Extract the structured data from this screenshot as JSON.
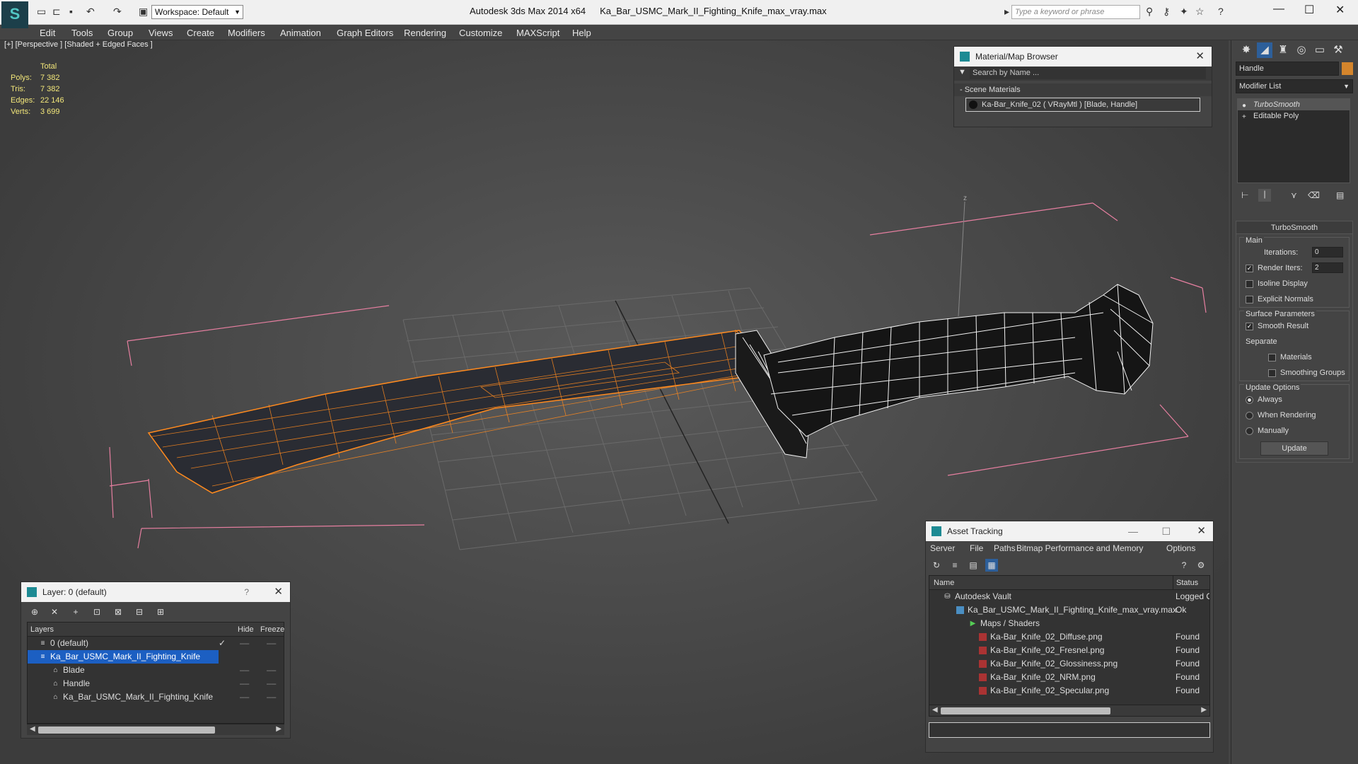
{
  "app": {
    "title": "Autodesk 3ds Max  2014 x64",
    "file": "Ka_Bar_USMC_Mark_II_Fighting_Knife_max_vray.max",
    "workspace": "Workspace: Default",
    "search_placeholder": "Type a keyword or phrase",
    "logo": "3ds-max-logo"
  },
  "menu": [
    "Edit",
    "Tools",
    "Group",
    "Views",
    "Create",
    "Modifiers",
    "Animation",
    "Graph Editors",
    "Rendering",
    "Customize",
    "MAXScript",
    "Help"
  ],
  "viewport": {
    "label": "[+] [Perspective ] [Shaded + Edged Faces ]",
    "stats": {
      "header": "Total",
      "rows": [
        {
          "label": "Polys:",
          "value": "7 382"
        },
        {
          "label": "Tris:",
          "value": "7 382"
        },
        {
          "label": "Edges:",
          "value": "22 146"
        },
        {
          "label": "Verts:",
          "value": "3 699"
        }
      ]
    },
    "axis_label": "z"
  },
  "material_browser": {
    "title": "Material/Map Browser",
    "search_placeholder": "Search by Name ...",
    "section": "- Scene Materials",
    "item": "Ka-Bar_Knife_02  ( VRayMtl )  [Blade, Handle]"
  },
  "command_panel": {
    "object_name": "Handle",
    "modifier_list": "Modifier List",
    "stack": [
      "TurboSmooth",
      "Editable Poly"
    ],
    "rollout_title": "TurboSmooth",
    "main_group": "Main",
    "iterations_label": "Iterations:",
    "iterations_value": "0",
    "render_iters_label": "Render Iters:",
    "render_iters_value": "2",
    "isoline": "Isoline Display",
    "explicit": "Explicit Normals",
    "surface_group": "Surface Parameters",
    "smooth_result": "Smooth Result",
    "separate": "Separate",
    "materials": "Materials",
    "smoothing_groups": "Smoothing Groups",
    "update_group": "Update Options",
    "always": "Always",
    "when_rendering": "When Rendering",
    "manually": "Manually",
    "update_button": "Update",
    "accent": "#d4852c"
  },
  "layer_panel": {
    "title": "Layer: 0 (default)",
    "help": "?",
    "columns": {
      "layers": "Layers",
      "hide": "Hide",
      "freeze": "Freeze"
    },
    "rows": [
      {
        "label": "0 (default)",
        "indent": 1,
        "sel": false
      },
      {
        "label": "Ka_Bar_USMC_Mark_II_Fighting_Knife",
        "indent": 1,
        "sel": true
      },
      {
        "label": "Blade",
        "indent": 2,
        "sel": false
      },
      {
        "label": "Handle",
        "indent": 2,
        "sel": false
      },
      {
        "label": "Ka_Bar_USMC_Mark_II_Fighting_Knife",
        "indent": 2,
        "sel": false
      }
    ]
  },
  "asset_tracking": {
    "title": "Asset Tracking",
    "menu": [
      "Server",
      "File",
      "Paths",
      "Bitmap Performance and Memory",
      "Options"
    ],
    "columns": {
      "name": "Name",
      "status": "Status"
    },
    "rows": [
      {
        "name": "Autodesk Vault",
        "status": "Logged O",
        "indent": 1
      },
      {
        "name": "Ka_Bar_USMC_Mark_II_Fighting_Knife_max_vray.max",
        "status": "Ok",
        "indent": 2
      },
      {
        "name": "Maps / Shaders",
        "status": "",
        "indent": 3
      },
      {
        "name": "Ka-Bar_Knife_02_Diffuse.png",
        "status": "Found",
        "indent": 4
      },
      {
        "name": "Ka-Bar_Knife_02_Fresnel.png",
        "status": "Found",
        "indent": 4
      },
      {
        "name": "Ka-Bar_Knife_02_Glossiness.png",
        "status": "Found",
        "indent": 4
      },
      {
        "name": "Ka-Bar_Knife_02_NRM.png",
        "status": "Found",
        "indent": 4
      },
      {
        "name": "Ka-Bar_Knife_02_Specular.png",
        "status": "Found",
        "indent": 4
      }
    ]
  }
}
